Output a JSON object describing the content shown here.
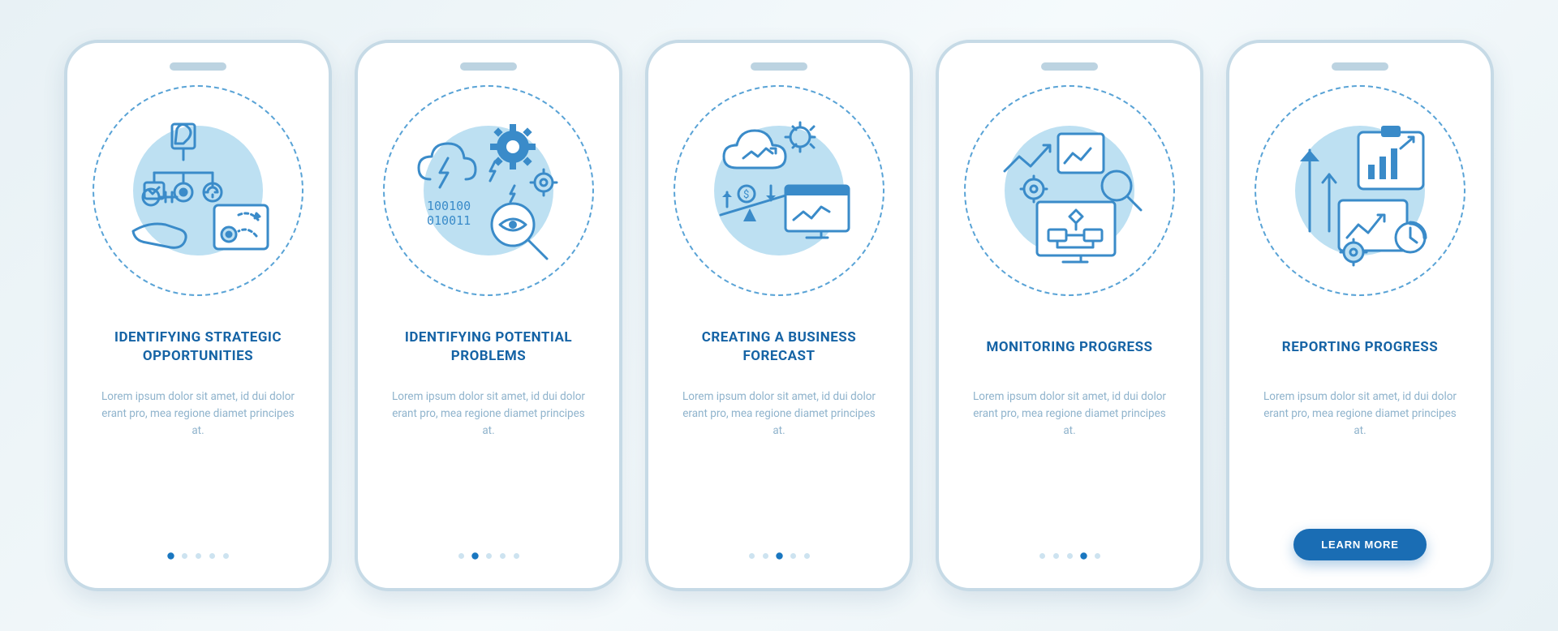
{
  "colors": {
    "accent": "#1a6db4",
    "stroke": "#3a8bc9",
    "fill_light": "#bde0f2",
    "text_title": "#1563a5",
    "text_body": "#8fb3cc"
  },
  "cta_label": "LEARN MORE",
  "screens": [
    {
      "icon": "strategic-opportunities-icon",
      "title": "IDENTIFYING STRATEGIC OPPORTUNITIES",
      "body": "Lorem ipsum dolor sit amet, id dui dolor erant pro, mea regione diamet principes at.",
      "active_dot": 0,
      "show_cta": false
    },
    {
      "icon": "potential-problems-icon",
      "title": "IDENTIFYING POTENTIAL PROBLEMS",
      "body": "Lorem ipsum dolor sit amet, id dui dolor erant pro, mea regione diamet principes at.",
      "active_dot": 1,
      "show_cta": false
    },
    {
      "icon": "business-forecast-icon",
      "title": "CREATING A BUSINESS FORECAST",
      "body": "Lorem ipsum dolor sit amet, id dui dolor erant pro, mea regione diamet principes at.",
      "active_dot": 2,
      "show_cta": false
    },
    {
      "icon": "monitoring-progress-icon",
      "title": "MONITORING PROGRESS",
      "body": "Lorem ipsum dolor sit amet, id dui dolor erant pro, mea regione diamet principes at.",
      "active_dot": 3,
      "show_cta": false
    },
    {
      "icon": "reporting-progress-icon",
      "title": "REPORTING PROGRESS",
      "body": "Lorem ipsum dolor sit amet, id dui dolor erant pro, mea regione diamet principes at.",
      "active_dot": 4,
      "show_cta": true
    }
  ]
}
